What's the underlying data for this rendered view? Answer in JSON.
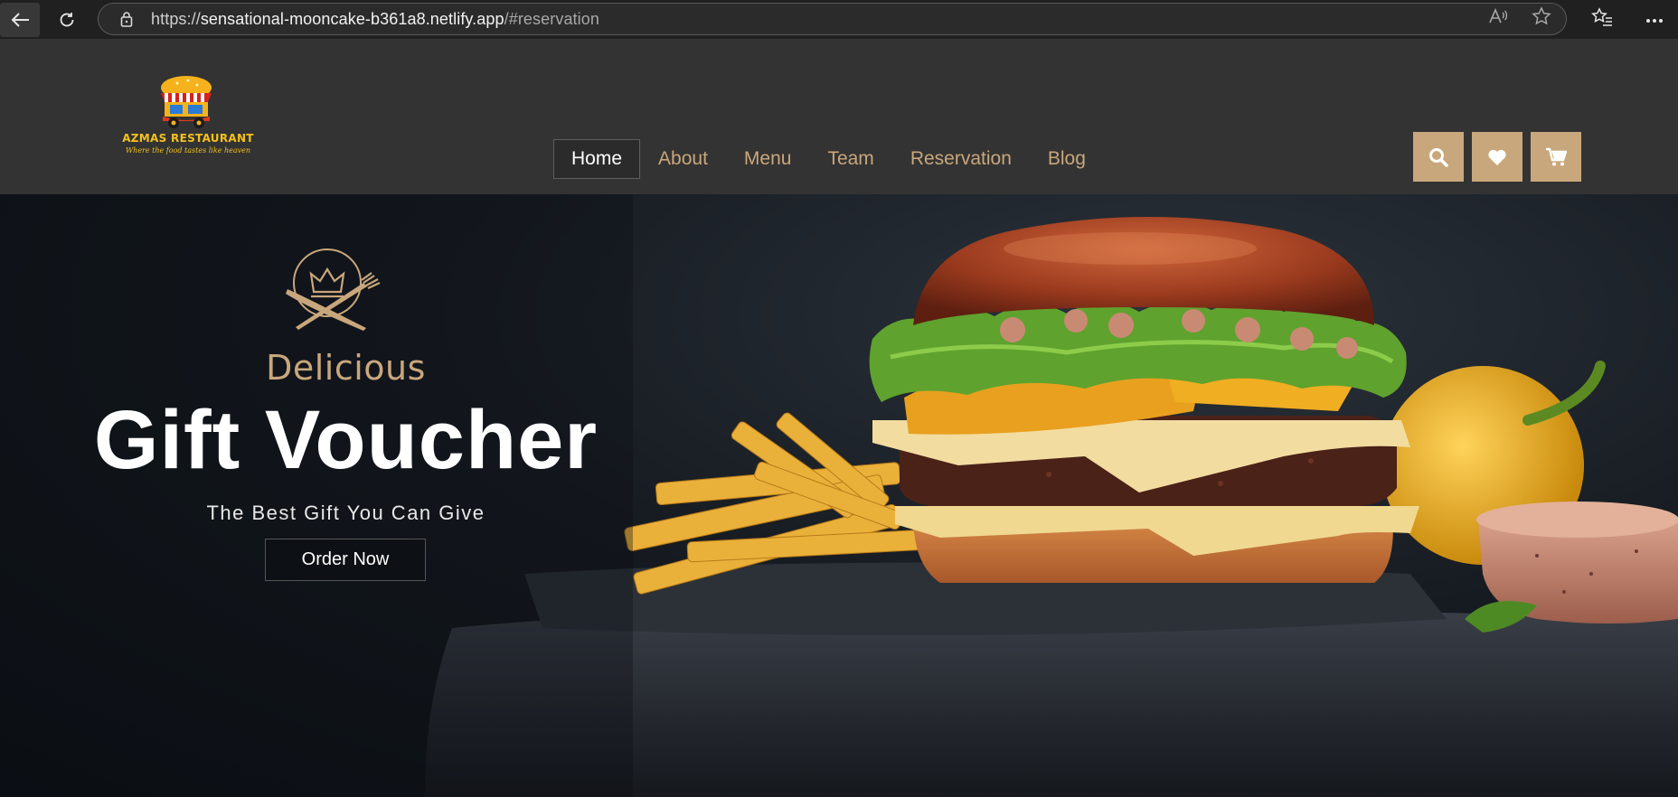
{
  "browser": {
    "url_scheme": "https://",
    "url_host": "sensational-mooncake-b361a8.netlify.app",
    "url_path": "/#reservation"
  },
  "site": {
    "logo_name": "AZMAS RESTAURANT",
    "logo_tagline": "Where the food tastes like heaven",
    "nav": [
      {
        "label": "Home",
        "active": true
      },
      {
        "label": "About"
      },
      {
        "label": "Menu"
      },
      {
        "label": "Team"
      },
      {
        "label": "Reservation"
      },
      {
        "label": "Blog"
      }
    ],
    "header_icons": [
      "search-icon",
      "heart-icon",
      "cart-icon"
    ],
    "accent_color": "#c9a77c"
  },
  "hero": {
    "kicker": "Delicious",
    "title": "Gift Voucher",
    "subtitle": "The Best Gift You Can Give",
    "cta": "Order Now"
  }
}
